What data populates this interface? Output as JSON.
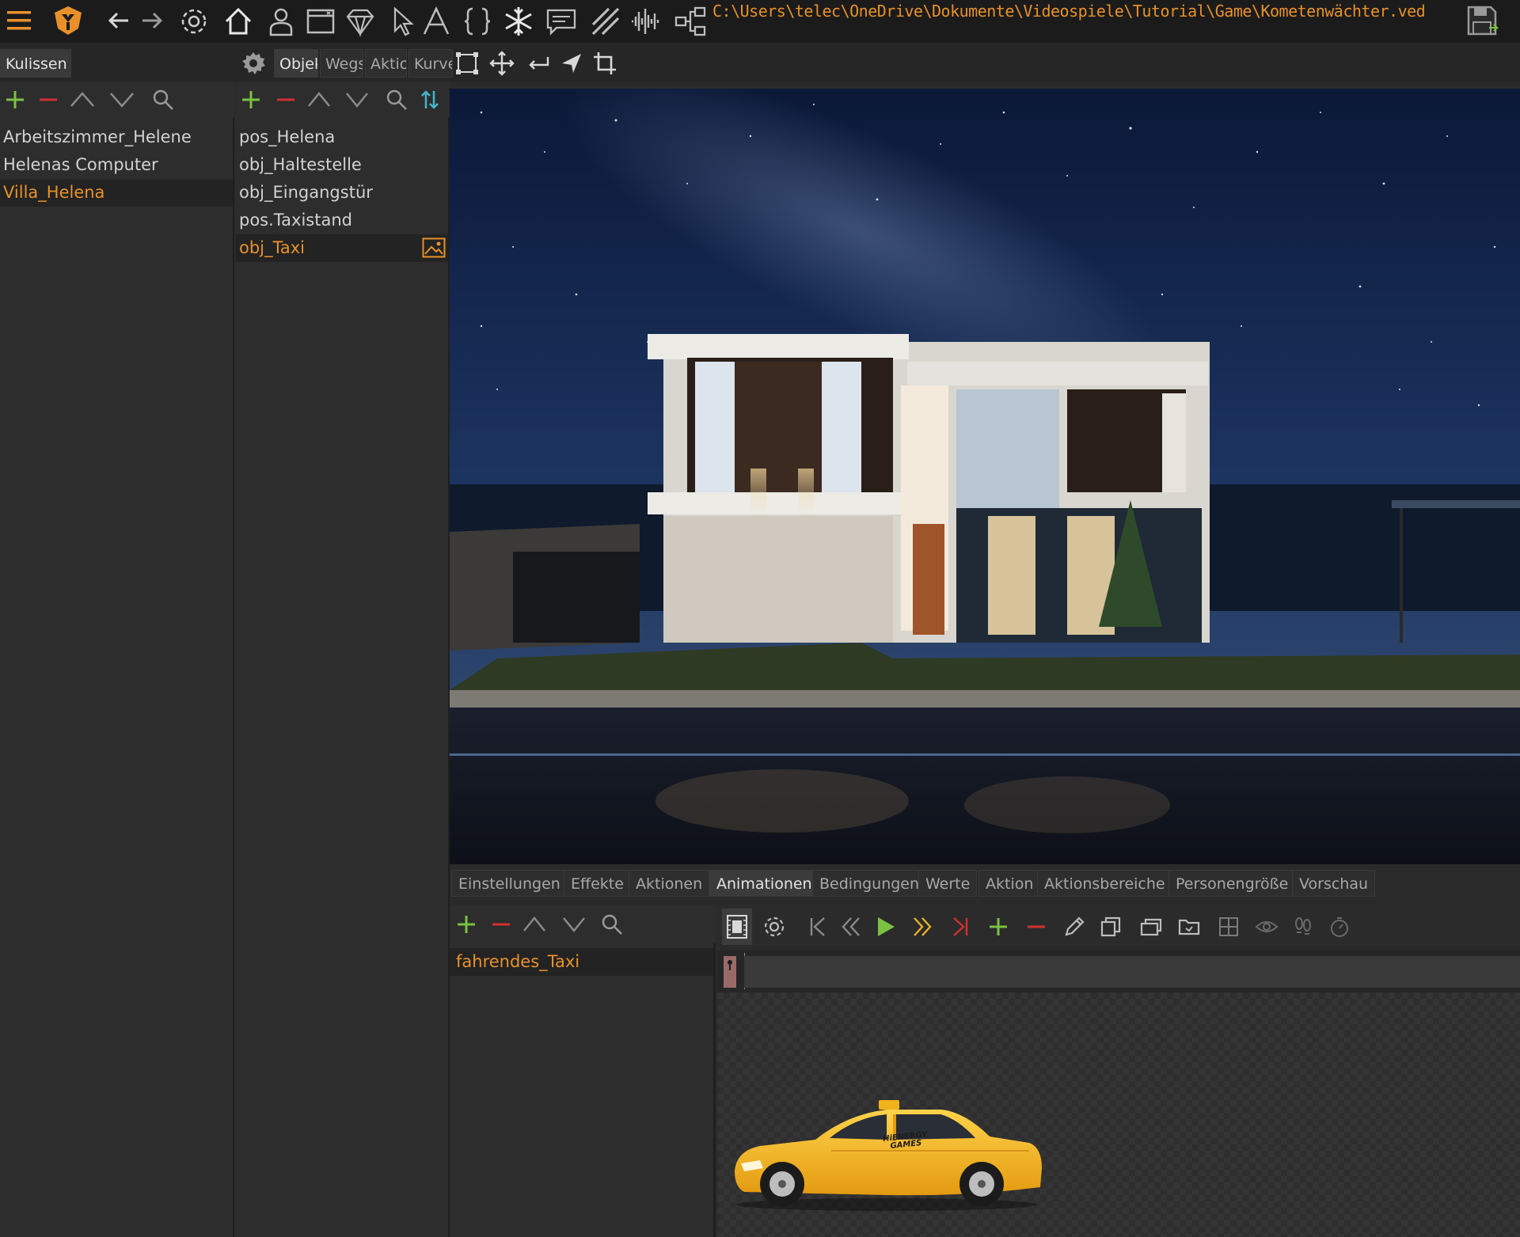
{
  "app": {
    "file_path": "C:\\Users\\telec\\OneDrive\\Dokumente\\Videospiele\\Tutorial\\Game\\Kometenwächter.ved"
  },
  "top_toolbar": {
    "icons": [
      "menu-icon",
      "logo-icon",
      "back-arrow-icon",
      "forward-arrow-icon",
      "settings-gear-icon",
      "home-icon",
      "person-icon",
      "window-icon",
      "diamond-icon",
      "cursor-icon",
      "text-icon",
      "braces-icon",
      "snowflake-icon",
      "speech-bubble-icon",
      "hatch-icon",
      "audio-wave-icon",
      "flow-diagram-icon",
      "save-icon"
    ]
  },
  "scenes_panel": {
    "tab_label": "Kulissen",
    "items": [
      {
        "label": "Arbeitszimmer_Helene",
        "selected": false
      },
      {
        "label": "Helenas Computer",
        "selected": false
      },
      {
        "label": "Villa_Helena",
        "selected": true
      }
    ]
  },
  "objects_panel": {
    "tabs": [
      {
        "label": "Objekte",
        "active": true
      },
      {
        "label": "Wegsysteme",
        "active": false
      },
      {
        "label": "Aktionsbereiche",
        "active": false
      },
      {
        "label": "Kurven",
        "active": false
      }
    ],
    "items": [
      {
        "label": "pos_Helena",
        "selected": false
      },
      {
        "label": "obj_Haltestelle",
        "selected": false
      },
      {
        "label": "obj_Eingangstür",
        "selected": false
      },
      {
        "label": "pos.Taxistand",
        "selected": false
      },
      {
        "label": "obj_Taxi",
        "selected": true
      }
    ]
  },
  "bottom_tabs": [
    {
      "label": "Einstellungen",
      "active": false
    },
    {
      "label": "Effekte",
      "active": false
    },
    {
      "label": "Aktionen",
      "active": false
    },
    {
      "label": "Animationen",
      "active": true
    },
    {
      "label": "Bedingungen",
      "active": false
    },
    {
      "label": "Werte",
      "active": false
    },
    {
      "label": "Aktion",
      "active": false
    },
    {
      "label": "Aktionsbereiche",
      "active": false
    },
    {
      "label": "Personengröße",
      "active": false
    },
    {
      "label": "Vorschau",
      "active": false
    }
  ],
  "animations": {
    "items": [
      {
        "label": "fahrendes_Taxi",
        "selected": true
      }
    ]
  },
  "taxi": {
    "brand_text": "HiENERGY GAMES"
  },
  "colors": {
    "accent_orange": "#e8912a",
    "add_green": "#7ac142",
    "remove_red": "#d23030",
    "teal": "#3fb8c9",
    "taxi_yellow": "#f2b21b"
  }
}
